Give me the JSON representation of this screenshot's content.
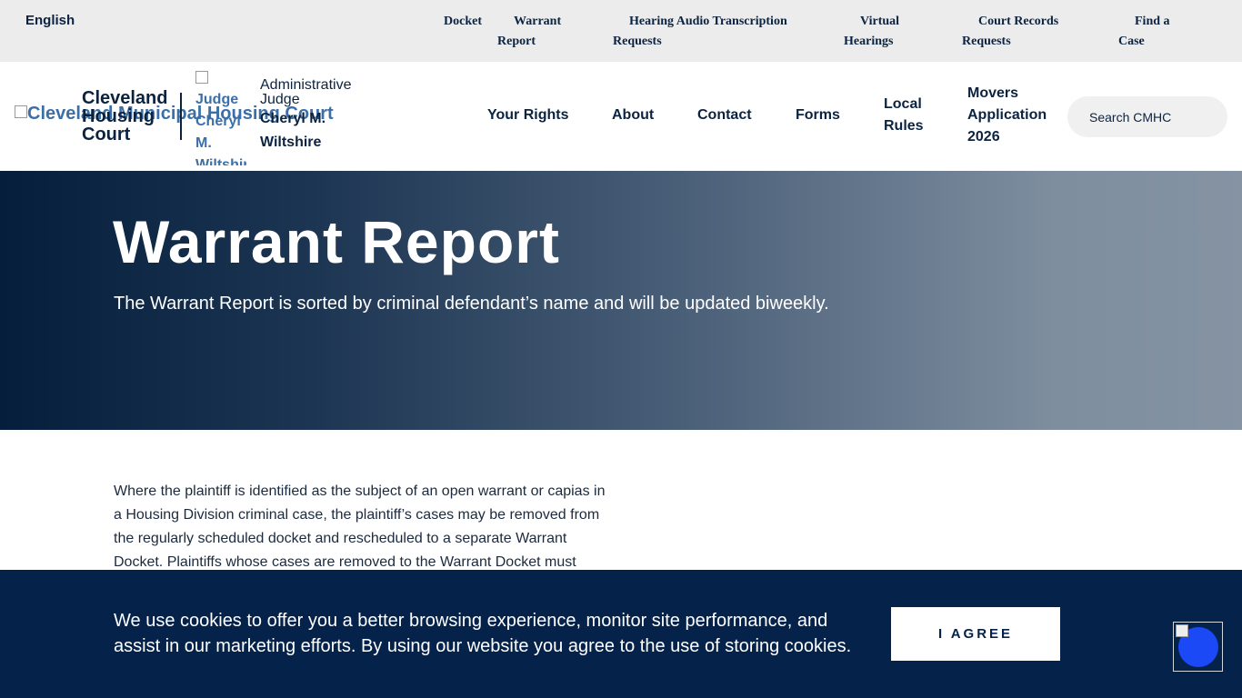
{
  "topbar": {
    "language": "English",
    "links": [
      {
        "id": "docket",
        "lines": [
          "Docket"
        ]
      },
      {
        "id": "warrant-report",
        "lines": [
          "Warrant",
          "Report"
        ]
      },
      {
        "id": "hearing-audio",
        "lines": [
          "Hearing Audio Transcription",
          "Requests"
        ]
      },
      {
        "id": "virtual-hearings",
        "lines": [
          "Virtual",
          "Hearings"
        ]
      },
      {
        "id": "court-records",
        "lines": [
          "Court Records",
          "Requests"
        ]
      },
      {
        "id": "find-a-case",
        "lines": [
          "Find a",
          "Case"
        ]
      }
    ]
  },
  "header": {
    "logo_alt": "Cleveland Municipal Housing Court",
    "brand_lines": [
      "Cleveland",
      "Housing",
      "Court"
    ],
    "judge_image_alt": "Judge Cheryl M. Wiltshire",
    "judge_title": "Administrative Judge",
    "judge_name": "Cheryl M. Wiltshire",
    "nav": [
      {
        "id": "your-rights",
        "lines": [
          "Your Rights"
        ]
      },
      {
        "id": "about",
        "lines": [
          "About"
        ]
      },
      {
        "id": "contact",
        "lines": [
          "Contact"
        ]
      },
      {
        "id": "forms",
        "lines": [
          "Forms"
        ]
      },
      {
        "id": "local-rules",
        "lines": [
          "Local",
          "Rules"
        ]
      },
      {
        "id": "movers-application",
        "lines": [
          "Movers",
          "Application",
          "2026"
        ]
      }
    ],
    "search_placeholder": "Search CMHC"
  },
  "hero": {
    "title": "Warrant Report",
    "subtitle": "The Warrant Report is sorted by criminal defendant’s name and will be updated biweekly."
  },
  "content": {
    "paragraph": "Where the plaintiff is identified as the subject of an open warrant or capias in a Housing Division criminal case, the plaintiff’s cases may be removed from the regularly scheduled docket and rescheduled to a separate Warrant Docket. Plaintiffs whose cases are removed to the Warrant Docket must"
  },
  "cookie": {
    "text": "We use cookies to offer you a better browsing experience, monitor site performance, and assist in our marketing efforts. By using our website you agree to the use of storing cookies.",
    "agree_label": "I AGREE"
  },
  "colors": {
    "navy": "#0c2340",
    "banner_bg": "#04224a",
    "topbar_bg": "#ececec",
    "widget_blue": "#1a49f5"
  }
}
